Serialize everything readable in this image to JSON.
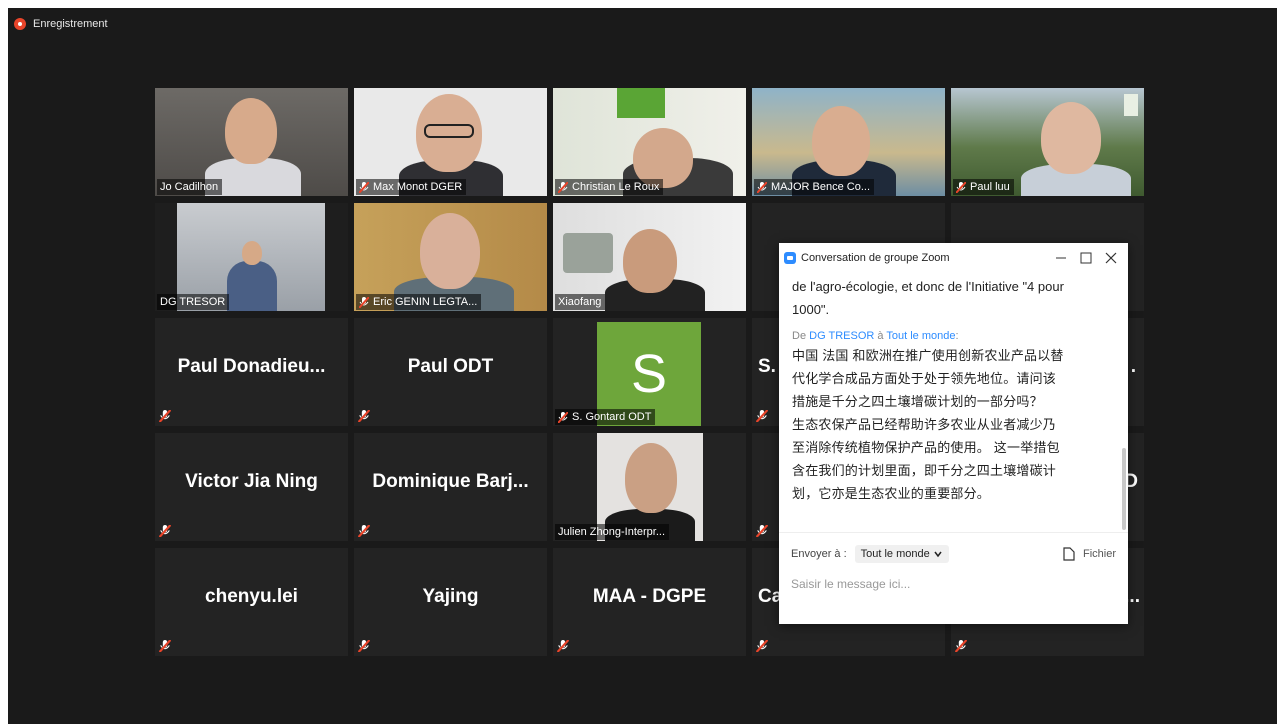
{
  "recording": {
    "label": "Enregistrement"
  },
  "participants": {
    "video": [
      {
        "name": "Jo Cadilhon"
      },
      {
        "name": "Max Monot DGER"
      },
      {
        "name": "Christian Le Roux"
      },
      {
        "name": "MAJOR Bence Co..."
      },
      {
        "name": "Paul luu"
      },
      {
        "name": "DG TRESOR"
      },
      {
        "name": "Eric GENIN LEGTA..."
      },
      {
        "name": "Xiaofang"
      }
    ],
    "named": [
      {
        "name": "Paul  Donadieu..."
      },
      {
        "name": "Paul ODT"
      },
      {
        "name": "Victor Jia Ning"
      },
      {
        "name": "Dominique  Barj..."
      },
      {
        "name": "chenyu.lei"
      },
      {
        "name": "Yajing"
      },
      {
        "name": "MAA - DGPE"
      }
    ],
    "gontard": {
      "initial": "S",
      "name": "S. Gontard ODT"
    },
    "julien": {
      "name": "Julien Zhong-Interpr..."
    },
    "partial": {
      "s": "S.",
      "dots1": ".",
      "p": "D",
      "ca": "Ca",
      "dots2": "..."
    }
  },
  "chat": {
    "title": "Conversation de groupe Zoom",
    "previous_message": "de l'agro-écologie, et donc de l'Initiative \"4 pour 1000\".",
    "sender_prefix": "De ",
    "sender_name": "DG TRESOR",
    "sender_mid": " à ",
    "recipient": "Tout le monde",
    "sender_suffix": ":",
    "message_lines": [
      "中国 法国 和欧洲在推广使用创新农业产品以替",
      "代化学合成品方面处于处于领先地位。请问该",
      "措施是千分之四土壤增碳计划的一部分吗？",
      "生态农保产品已经帮助许多农业从业者减少乃",
      "至消除传统植物保护产品的使用。 这一举措包",
      "含在我们的计划里面，即千分之四土壤增碳计",
      "划，它亦是生态农业的重要部分。"
    ],
    "send_to_label": "Envoyer à :",
    "send_to_value": "Tout le monde",
    "file_label": "Fichier",
    "input_placeholder": "Saisir le message ici..."
  },
  "colors": {
    "accent": "#2d8cff",
    "active_speaker": "#cfe03b",
    "mute": "#e8442a",
    "avatar": "#6ea63b"
  }
}
